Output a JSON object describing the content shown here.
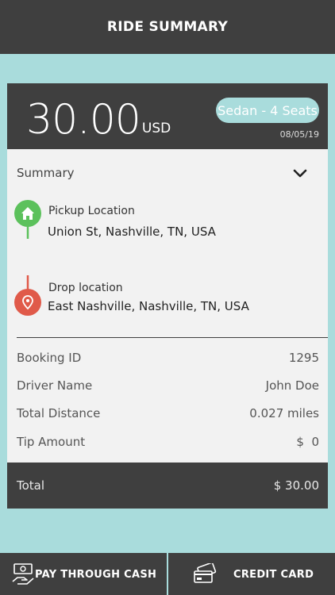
{
  "header": {
    "title": "RIDE SUMMARY"
  },
  "fare": {
    "amount": "30.00",
    "currency": "USD",
    "vehicle": "Sedan - 4 Seats",
    "date": "08/05/19"
  },
  "summary": {
    "label": "Summary",
    "pickup": {
      "label": "Pickup Location",
      "value": "Union St, Nashville, TN, USA"
    },
    "drop": {
      "label": "Drop location",
      "value": "East Nashville, Nashville, TN, USA"
    }
  },
  "details": [
    {
      "label": "Booking ID",
      "value": "1295"
    },
    {
      "label": "Driver Name",
      "value": "John Doe"
    },
    {
      "label": "Total Distance",
      "value": "0.027 miles"
    },
    {
      "label": "Tip Amount",
      "value": "$  0"
    }
  ],
  "total": {
    "label": "Total",
    "value": "$ 30.00"
  },
  "actions": {
    "cash_label": "PAY THROUGH CASH",
    "card_label": "CREDIT CARD"
  },
  "colors": {
    "dark": "#3f3f3f",
    "accent": "#a9dcdc",
    "pickup_pin": "#5cc15c",
    "drop_pin": "#e05a4a"
  },
  "icons": {
    "summary_toggle": "chevron-down-icon",
    "pickup": "home-pin-icon",
    "drop": "location-pin-icon",
    "cash": "cash-hand-icon",
    "card": "credit-card-icon"
  }
}
